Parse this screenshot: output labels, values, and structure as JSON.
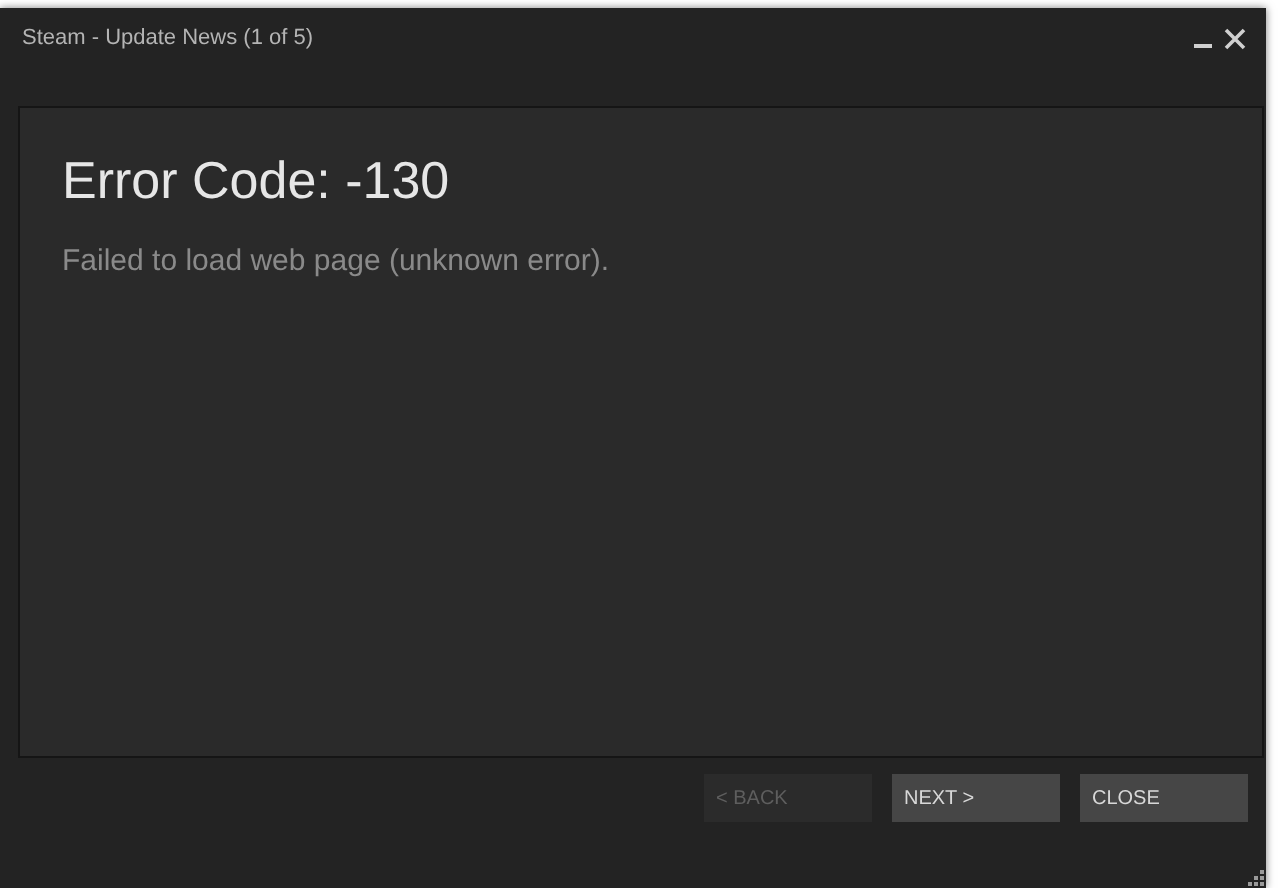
{
  "window": {
    "title": "Steam - Update News (1 of 5)"
  },
  "content": {
    "heading": "Error Code: -130",
    "message": "Failed to load web page (unknown error)."
  },
  "buttons": [
    {
      "label": "< BACK",
      "disabled": true
    },
    {
      "label": "NEXT >",
      "disabled": false
    },
    {
      "label": "CLOSE",
      "disabled": false
    }
  ]
}
